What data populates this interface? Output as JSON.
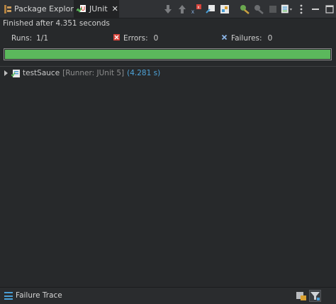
{
  "tabs": {
    "package_explorer": "Package Explorer",
    "junit": "JUnit"
  },
  "status": {
    "message": "Finished after 4.351 seconds"
  },
  "counters": {
    "runs_label": "Runs:",
    "runs_value": "1/1",
    "errors_label": "Errors:",
    "errors_value": "0",
    "failures_label": "Failures:",
    "failures_value": "0"
  },
  "progress": {
    "fraction": 1.0,
    "color": "#5bb85c"
  },
  "tree": {
    "items": [
      {
        "name": "testSauce",
        "runner": "[Runner: JUnit 5]",
        "time": "(4.281 s)"
      }
    ]
  },
  "bottom": {
    "label": "Failure Trace"
  },
  "colors": {
    "background": "#27292b",
    "accent": "#4a9fd6",
    "error_red": "#d9443b",
    "success": "#5bb85c"
  }
}
